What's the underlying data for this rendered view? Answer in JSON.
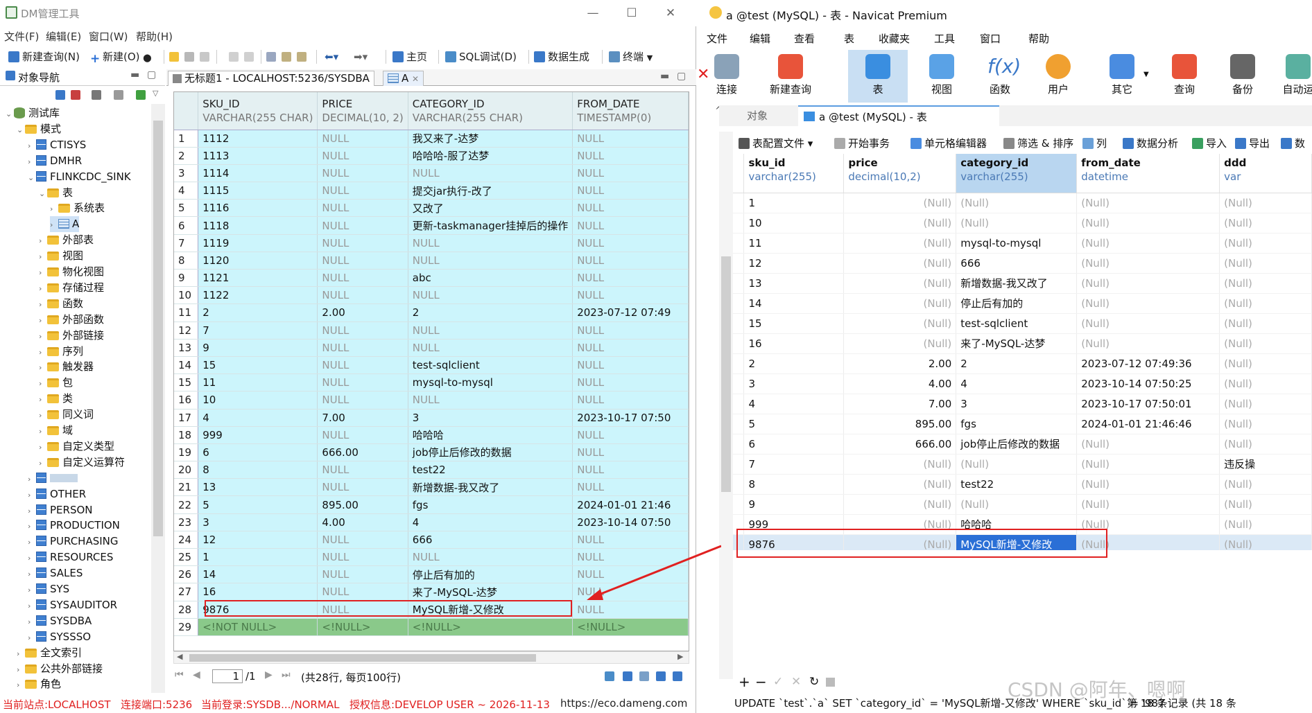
{
  "dm": {
    "title": "DM管理工具",
    "menu": [
      "文件(F)",
      "编辑(E)",
      "窗口(W)",
      "帮助(H)"
    ],
    "toolbar": {
      "new_query": "新建查询(N)",
      "new": "新建(O)",
      "home": "主页",
      "sql_debug": "SQL调试(D)",
      "data_gen": "数据生成",
      "terminal": "终端"
    },
    "nav_title": "对象导航",
    "tree": [
      {
        "label": "测试库",
        "level": 0,
        "icon": "db-icon",
        "arrow": "v"
      },
      {
        "label": "模式",
        "level": 1,
        "icon": "folder-icon",
        "arrow": "v"
      },
      {
        "label": "CTISYS",
        "level": 2,
        "icon": "schema-icon",
        "arrow": ">"
      },
      {
        "label": "DMHR",
        "level": 2,
        "icon": "schema-icon",
        "arrow": ">"
      },
      {
        "label": "FLINKCDC_SINK",
        "level": 2,
        "icon": "schema-icon",
        "arrow": "v"
      },
      {
        "label": "表",
        "level": 3,
        "icon": "folder-icon",
        "arrow": "v"
      },
      {
        "label": "系统表",
        "level": 4,
        "icon": "folder-icon",
        "arrow": ">"
      },
      {
        "label": "A",
        "level": 4,
        "icon": "table-icon",
        "arrow": ">"
      },
      {
        "label": "外部表",
        "level": 3,
        "icon": "folder-icon",
        "arrow": ">"
      },
      {
        "label": "视图",
        "level": 3,
        "icon": "folder-icon",
        "arrow": ">"
      },
      {
        "label": "物化视图",
        "level": 3,
        "icon": "folder-icon",
        "arrow": ">"
      },
      {
        "label": "存储过程",
        "level": 3,
        "icon": "folder-icon",
        "arrow": ">"
      },
      {
        "label": "函数",
        "level": 3,
        "icon": "folder-icon",
        "arrow": ">"
      },
      {
        "label": "外部函数",
        "level": 3,
        "icon": "folder-icon",
        "arrow": ">"
      },
      {
        "label": "外部链接",
        "level": 3,
        "icon": "folder-icon",
        "arrow": ">"
      },
      {
        "label": "序列",
        "level": 3,
        "icon": "folder-icon",
        "arrow": ">"
      },
      {
        "label": "触发器",
        "level": 3,
        "icon": "folder-icon",
        "arrow": ">"
      },
      {
        "label": "包",
        "level": 3,
        "icon": "folder-icon",
        "arrow": ">"
      },
      {
        "label": "类",
        "level": 3,
        "icon": "folder-icon",
        "arrow": ">"
      },
      {
        "label": "同义词",
        "level": 3,
        "icon": "folder-icon",
        "arrow": ">"
      },
      {
        "label": "域",
        "level": 3,
        "icon": "folder-icon",
        "arrow": ">"
      },
      {
        "label": "自定义类型",
        "level": 3,
        "icon": "folder-icon",
        "arrow": ">"
      },
      {
        "label": "自定义运算符",
        "level": 3,
        "icon": "folder-icon",
        "arrow": ">"
      },
      {
        "label": "",
        "level": 2,
        "icon": "schema-icon",
        "arrow": ">"
      },
      {
        "label": "OTHER",
        "level": 2,
        "icon": "schema-icon",
        "arrow": ">"
      },
      {
        "label": "PERSON",
        "level": 2,
        "icon": "schema-icon",
        "arrow": ">"
      },
      {
        "label": "PRODUCTION",
        "level": 2,
        "icon": "schema-icon",
        "arrow": ">"
      },
      {
        "label": "PURCHASING",
        "level": 2,
        "icon": "schema-icon",
        "arrow": ">"
      },
      {
        "label": "RESOURCES",
        "level": 2,
        "icon": "schema-icon",
        "arrow": ">"
      },
      {
        "label": "SALES",
        "level": 2,
        "icon": "schema-icon",
        "arrow": ">"
      },
      {
        "label": "SYS",
        "level": 2,
        "icon": "schema-icon",
        "arrow": ">"
      },
      {
        "label": "SYSAUDITOR",
        "level": 2,
        "icon": "schema-icon",
        "arrow": ">"
      },
      {
        "label": "SYSDBA",
        "level": 2,
        "icon": "schema-icon",
        "arrow": ">"
      },
      {
        "label": "SYSSSO",
        "level": 2,
        "icon": "schema-icon",
        "arrow": ">"
      },
      {
        "label": "全文索引",
        "level": 1,
        "icon": "folder-icon",
        "arrow": ">"
      },
      {
        "label": "公共外部链接",
        "level": 1,
        "icon": "folder-icon",
        "arrow": ">"
      },
      {
        "label": "角色",
        "level": 1,
        "icon": "folder-icon",
        "arrow": ">"
      }
    ],
    "tabs": [
      "无标题1 - LOCALHOST:5236/SYSDBA",
      "A"
    ],
    "columns": [
      {
        "name": "SKU_ID",
        "type": "VARCHAR(255 CHAR)"
      },
      {
        "name": "PRICE",
        "type": "DECIMAL(10, 2)"
      },
      {
        "name": "CATEGORY_ID",
        "type": "VARCHAR(255 CHAR)"
      },
      {
        "name": "FROM_DATE",
        "type": "TIMESTAMP(0)"
      }
    ],
    "rows": [
      [
        "1",
        "1112",
        "NULL",
        "我又来了-达梦",
        "NULL"
      ],
      [
        "2",
        "1113",
        "NULL",
        "哈哈哈-服了达梦",
        "NULL"
      ],
      [
        "3",
        "1114",
        "NULL",
        "NULL",
        "NULL"
      ],
      [
        "4",
        "1115",
        "NULL",
        "提交jar执行-改了",
        "NULL"
      ],
      [
        "5",
        "1116",
        "NULL",
        "又改了",
        "NULL"
      ],
      [
        "6",
        "1118",
        "NULL",
        "更新-taskmanager挂掉后的操作",
        "NULL"
      ],
      [
        "7",
        "1119",
        "NULL",
        "NULL",
        "NULL"
      ],
      [
        "8",
        "1120",
        "NULL",
        "NULL",
        "NULL"
      ],
      [
        "9",
        "1121",
        "NULL",
        "abc",
        "NULL"
      ],
      [
        "10",
        "1122",
        "NULL",
        "NULL",
        "NULL"
      ],
      [
        "11",
        "2",
        "2.00",
        "2",
        "2023-07-12 07:49"
      ],
      [
        "12",
        "7",
        "NULL",
        "NULL",
        "NULL"
      ],
      [
        "13",
        "9",
        "NULL",
        "NULL",
        "NULL"
      ],
      [
        "14",
        "15",
        "NULL",
        "test-sqlclient",
        "NULL"
      ],
      [
        "15",
        "11",
        "NULL",
        "mysql-to-mysql",
        "NULL"
      ],
      [
        "16",
        "10",
        "NULL",
        "NULL",
        "NULL"
      ],
      [
        "17",
        "4",
        "7.00",
        "3",
        "2023-10-17 07:50"
      ],
      [
        "18",
        "999",
        "NULL",
        "哈哈哈",
        "NULL"
      ],
      [
        "19",
        "6",
        "666.00",
        "job停止后修改的数据",
        "NULL"
      ],
      [
        "20",
        "8",
        "NULL",
        "test22",
        "NULL"
      ],
      [
        "21",
        "13",
        "NULL",
        "新增数据-我又改了",
        "NULL"
      ],
      [
        "22",
        "5",
        "895.00",
        "fgs",
        "2024-01-01 21:46"
      ],
      [
        "23",
        "3",
        "4.00",
        "4",
        "2023-10-14 07:50"
      ],
      [
        "24",
        "12",
        "NULL",
        "666",
        "NULL"
      ],
      [
        "25",
        "1",
        "NULL",
        "NULL",
        "NULL"
      ],
      [
        "26",
        "14",
        "NULL",
        "停止后有加的",
        "NULL"
      ],
      [
        "27",
        "16",
        "NULL",
        "来了-MySQL-达梦",
        "NULL"
      ],
      [
        "28",
        "9876",
        "NULL",
        "MySQL新增-又修改",
        "NULL"
      ]
    ],
    "new_row": [
      "29",
      "<!NOT NULL>",
      "<!NULL>",
      "<!NULL>",
      "<!NULL>"
    ],
    "pager": {
      "page": "1",
      "total": "/1",
      "summary": "(共28行, 每页100行)"
    },
    "status": {
      "site": "当前站点:LOCALHOST",
      "port": "连接端口:5236",
      "login": "当前登录:SYSDB.../NORMAL",
      "license": "授权信息:DEVELOP USER ~ 2026-11-13",
      "url": "https://eco.dameng.com"
    }
  },
  "nv": {
    "title": "a @test (MySQL) - 表 - Navicat Premium",
    "menu": [
      "文件",
      "编辑",
      "查看",
      "表",
      "收藏夹",
      "工具",
      "窗口",
      "帮助"
    ],
    "ribbon": [
      "连接",
      "新建查询",
      "表",
      "视图",
      "函数",
      "用户",
      "其它",
      "查询",
      "备份",
      "自动运"
    ],
    "tabs": {
      "objects": "对象",
      "current": "a @test (MySQL) - 表"
    },
    "actions": [
      "表配置文件",
      "开始事务",
      "单元格编辑器",
      "筛选 & 排序",
      "列",
      "数据分析",
      "导入",
      "导出",
      "数"
    ],
    "columns": [
      {
        "name": "sku_id",
        "type": "varchar(255)"
      },
      {
        "name": "price",
        "type": "decimal(10,2)"
      },
      {
        "name": "category_id",
        "type": "varchar(255)"
      },
      {
        "name": "from_date",
        "type": "datetime"
      },
      {
        "name": "ddd",
        "type": "var"
      }
    ],
    "rows": [
      [
        "1",
        "(Null)",
        "(Null)",
        "(Null)",
        "(Null)"
      ],
      [
        "10",
        "(Null)",
        "(Null)",
        "(Null)",
        "(Null)"
      ],
      [
        "11",
        "(Null)",
        "mysql-to-mysql",
        "(Null)",
        "(Null)"
      ],
      [
        "12",
        "(Null)",
        "666",
        "(Null)",
        "(Null)"
      ],
      [
        "13",
        "(Null)",
        "新增数据-我又改了",
        "(Null)",
        "(Null)"
      ],
      [
        "14",
        "(Null)",
        "停止后有加的",
        "(Null)",
        "(Null)"
      ],
      [
        "15",
        "(Null)",
        "test-sqlclient",
        "(Null)",
        "(Null)"
      ],
      [
        "16",
        "(Null)",
        "来了-MySQL-达梦",
        "(Null)",
        "(Null)"
      ],
      [
        "2",
        "2.00",
        "2",
        "2023-07-12 07:49:36",
        "(Null)"
      ],
      [
        "3",
        "4.00",
        "4",
        "2023-10-14 07:50:25",
        "(Null)"
      ],
      [
        "4",
        "7.00",
        "3",
        "2023-10-17 07:50:01",
        "(Null)"
      ],
      [
        "5",
        "895.00",
        "fgs",
        "2024-01-01 21:46:46",
        "(Null)"
      ],
      [
        "6",
        "666.00",
        "job停止后修改的数据",
        "(Null)",
        "(Null)"
      ],
      [
        "7",
        "(Null)",
        "(Null)",
        "(Null)",
        "违反操"
      ],
      [
        "8",
        "(Null)",
        "test22",
        "(Null)",
        "(Null)"
      ],
      [
        "9",
        "(Null)",
        "(Null)",
        "(Null)",
        "(Null)"
      ],
      [
        "999",
        "(Null)",
        "哈哈哈",
        "(Null)",
        "(Null)"
      ],
      [
        "9876",
        "(Null)",
        "MySQL新增-又修改",
        "(Null)",
        "(Null)"
      ]
    ],
    "sql": "UPDATE `test`.`a` SET `category_id` = 'MySQL新增-又修改' WHERE `sku_id` = '987",
    "record_info": "第 18 条记录 (共 18 条",
    "watermark": "CSDN @阿年、嗯啊"
  },
  "colors": {
    "dm_row": "#ccf5fc",
    "dm_new": "#8ac98a",
    "nv_sel": "#2a6fd6",
    "annot": "#e02020"
  }
}
